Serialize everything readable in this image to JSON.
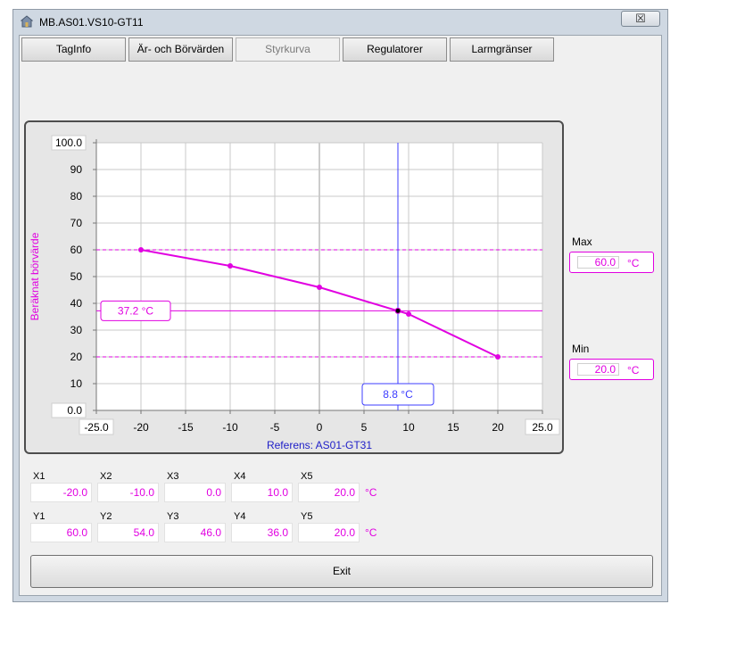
{
  "window": {
    "title": "MB.AS01.VS10-GT11",
    "close_glyph": "☒"
  },
  "tabs": [
    {
      "label": "TagInfo",
      "active": false
    },
    {
      "label": "Är- och Börvärden",
      "active": false
    },
    {
      "label": "Styrkurva",
      "active": true
    },
    {
      "label": "Regulatorer",
      "active": false
    },
    {
      "label": "Larmgränser",
      "active": false
    }
  ],
  "limits": {
    "max_label": "Max",
    "max_value": "60.0",
    "max_unit": "°C",
    "min_label": "Min",
    "min_value": "20.0",
    "min_unit": "°C"
  },
  "points": {
    "x_labels": [
      "X1",
      "X2",
      "X3",
      "X4",
      "X5"
    ],
    "x_values": [
      "-20.0",
      "-10.0",
      "0.0",
      "10.0",
      "20.0"
    ],
    "x_unit": "°C",
    "y_labels": [
      "Y1",
      "Y2",
      "Y3",
      "Y4",
      "Y5"
    ],
    "y_values": [
      "60.0",
      "54.0",
      "46.0",
      "36.0",
      "20.0"
    ],
    "y_unit": "°C"
  },
  "exit_label": "Exit",
  "colors": {
    "curve": "#e100e1",
    "cursor": "#3c3cff",
    "frame": "#4d4d4d"
  },
  "chart_data": {
    "type": "line",
    "xlabel": "Referens: AS01-GT31",
    "ylabel": "Beräknat börvärde",
    "xlim": [
      -25,
      25
    ],
    "ylim": [
      0,
      100
    ],
    "x_ticks": [
      "-25.0",
      "-20",
      "-15",
      "-10",
      "-5",
      "0",
      "5",
      "10",
      "15",
      "20",
      "25.0"
    ],
    "x_tick_values": [
      -25,
      -20,
      -15,
      -10,
      -5,
      0,
      5,
      10,
      15,
      20,
      25
    ],
    "y_ticks": [
      "100.0",
      "90",
      "80",
      "70",
      "60",
      "50",
      "40",
      "30",
      "20",
      "10",
      "0.0"
    ],
    "y_tick_values": [
      100,
      90,
      80,
      70,
      60,
      50,
      40,
      30,
      20,
      10,
      0
    ],
    "grid": true,
    "series": [
      {
        "x": [
          -20,
          -10,
          0,
          10,
          20
        ],
        "y": [
          60,
          54,
          46,
          36,
          20
        ]
      }
    ],
    "max_line": 60,
    "min_line": 20,
    "current": {
      "x": 8.8,
      "y": 37.2,
      "x_label": "8.8 °C",
      "y_label": "37.2 °C"
    }
  }
}
